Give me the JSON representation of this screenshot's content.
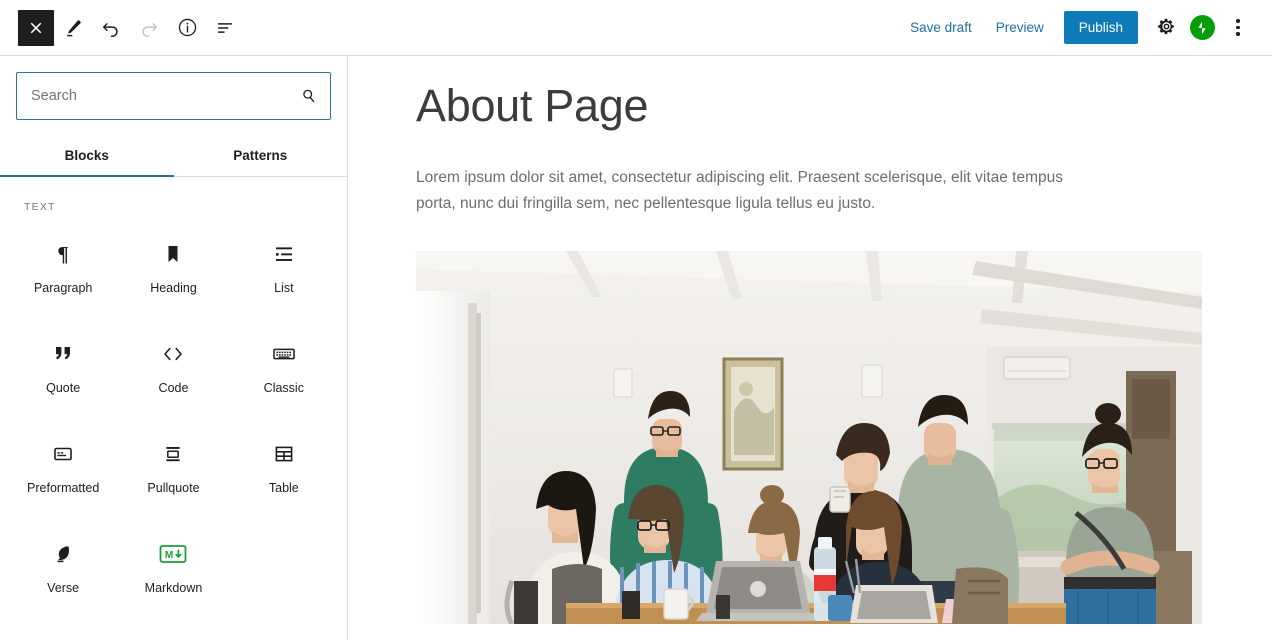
{
  "header": {
    "left_tools": [
      {
        "name": "close-editor-button",
        "icon": "close-icon",
        "label": "Close"
      },
      {
        "name": "edit-mode-button",
        "icon": "pencil-icon",
        "label": "Edit"
      },
      {
        "name": "undo-button",
        "icon": "undo-icon",
        "label": "Undo"
      },
      {
        "name": "redo-button",
        "icon": "redo-icon",
        "label": "Redo",
        "disabled": true
      },
      {
        "name": "details-button",
        "icon": "info-icon",
        "label": "Details"
      },
      {
        "name": "list-view-button",
        "icon": "list-view-icon",
        "label": "List view"
      }
    ],
    "save_draft_label": "Save draft",
    "preview_label": "Preview",
    "publish_label": "Publish",
    "settings_label": "Settings",
    "jetpack_label": "Jetpack",
    "more_options_label": "Options",
    "publish_color": "#0e7ab8",
    "link_color": "#1d6fa5",
    "jetpack_color": "#069e08"
  },
  "inserter": {
    "search": {
      "placeholder": "Search",
      "value": "",
      "icon": "search-icon",
      "border_color": "#2a7699"
    },
    "tabs": [
      {
        "label": "Blocks",
        "active": true
      },
      {
        "label": "Patterns",
        "active": false
      }
    ],
    "active_tab_underline_color": "#1e6f9a",
    "category_label": "TEXT",
    "blocks": [
      {
        "label": "Paragraph",
        "icon": "paragraph-icon"
      },
      {
        "label": "Heading",
        "icon": "heading-icon"
      },
      {
        "label": "List",
        "icon": "list-icon"
      },
      {
        "label": "Quote",
        "icon": "quote-icon"
      },
      {
        "label": "Code",
        "icon": "code-icon"
      },
      {
        "label": "Classic",
        "icon": "classic-icon"
      },
      {
        "label": "Preformatted",
        "icon": "preformatted-icon"
      },
      {
        "label": "Pullquote",
        "icon": "pullquote-icon"
      },
      {
        "label": "Table",
        "icon": "table-icon"
      },
      {
        "label": "Verse",
        "icon": "verse-icon"
      },
      {
        "label": "Markdown",
        "icon": "markdown-icon"
      }
    ],
    "markdown_badge_text": "M",
    "markdown_badge_color": "#1f9c3a"
  },
  "content": {
    "title": "About Page",
    "paragraph": "Lorem ipsum dolor sit amet, consectetur adipiscing elit. Praesent scelerisque, elit vitae tempus porta, nunc dui fringilla sem, nec pellentesque ligula tellus eu justo.",
    "image_alt": "Group of people gathered around laptops in a bright white room"
  }
}
